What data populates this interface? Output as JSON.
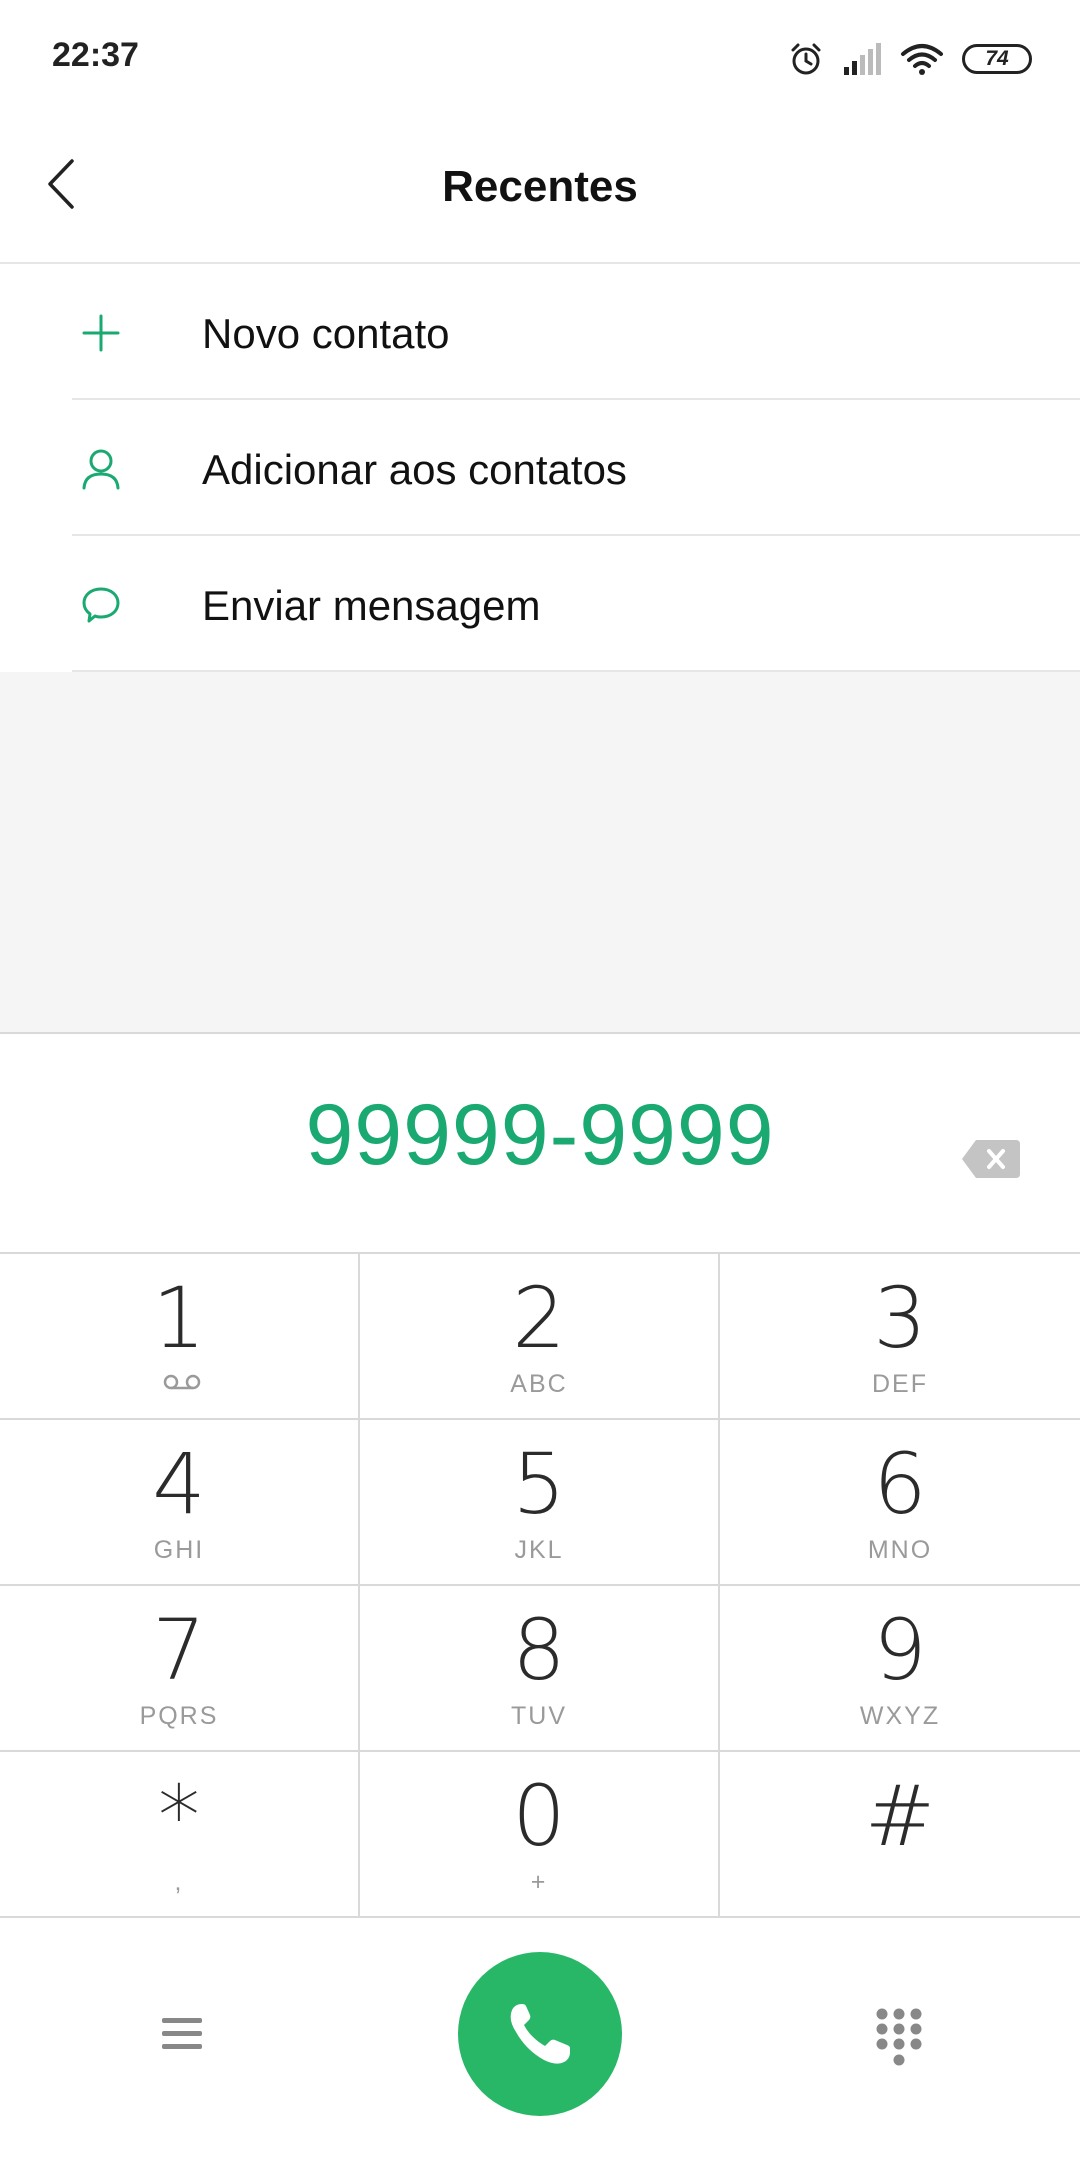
{
  "status_bar": {
    "time": "22:37",
    "battery_level": "74",
    "icons": [
      "alarm-icon",
      "signal-icon",
      "wifi-icon",
      "battery-icon"
    ]
  },
  "header": {
    "title": "Recentes",
    "back_icon": "chevron-left-icon"
  },
  "actions": [
    {
      "label": "Novo contato",
      "icon": "plus-icon"
    },
    {
      "label": "Adicionar aos contatos",
      "icon": "person-icon"
    },
    {
      "label": "Enviar mensagem",
      "icon": "chat-bubble-icon"
    }
  ],
  "dialer": {
    "number": "99999-9999",
    "backspace_icon": "backspace-icon"
  },
  "keypad": [
    {
      "digit": "1",
      "letters": "",
      "sub_icon": "voicemail-icon"
    },
    {
      "digit": "2",
      "letters": "ABC"
    },
    {
      "digit": "3",
      "letters": "DEF"
    },
    {
      "digit": "4",
      "letters": "GHI"
    },
    {
      "digit": "5",
      "letters": "JKL"
    },
    {
      "digit": "6",
      "letters": "MNO"
    },
    {
      "digit": "7",
      "letters": "PQRS"
    },
    {
      "digit": "8",
      "letters": "TUV"
    },
    {
      "digit": "9",
      "letters": "WXYZ"
    },
    {
      "digit": "*",
      "letters": ","
    },
    {
      "digit": "0",
      "letters": "+"
    },
    {
      "digit": "#",
      "letters": ""
    }
  ],
  "bottom_bar": {
    "menu_icon": "menu-icon",
    "call_icon": "phone-icon",
    "dialpad_icon": "dialpad-icon"
  },
  "colors": {
    "accent": "#19a971",
    "call_button": "#27b767",
    "grey_background": "#f5f5f5"
  }
}
